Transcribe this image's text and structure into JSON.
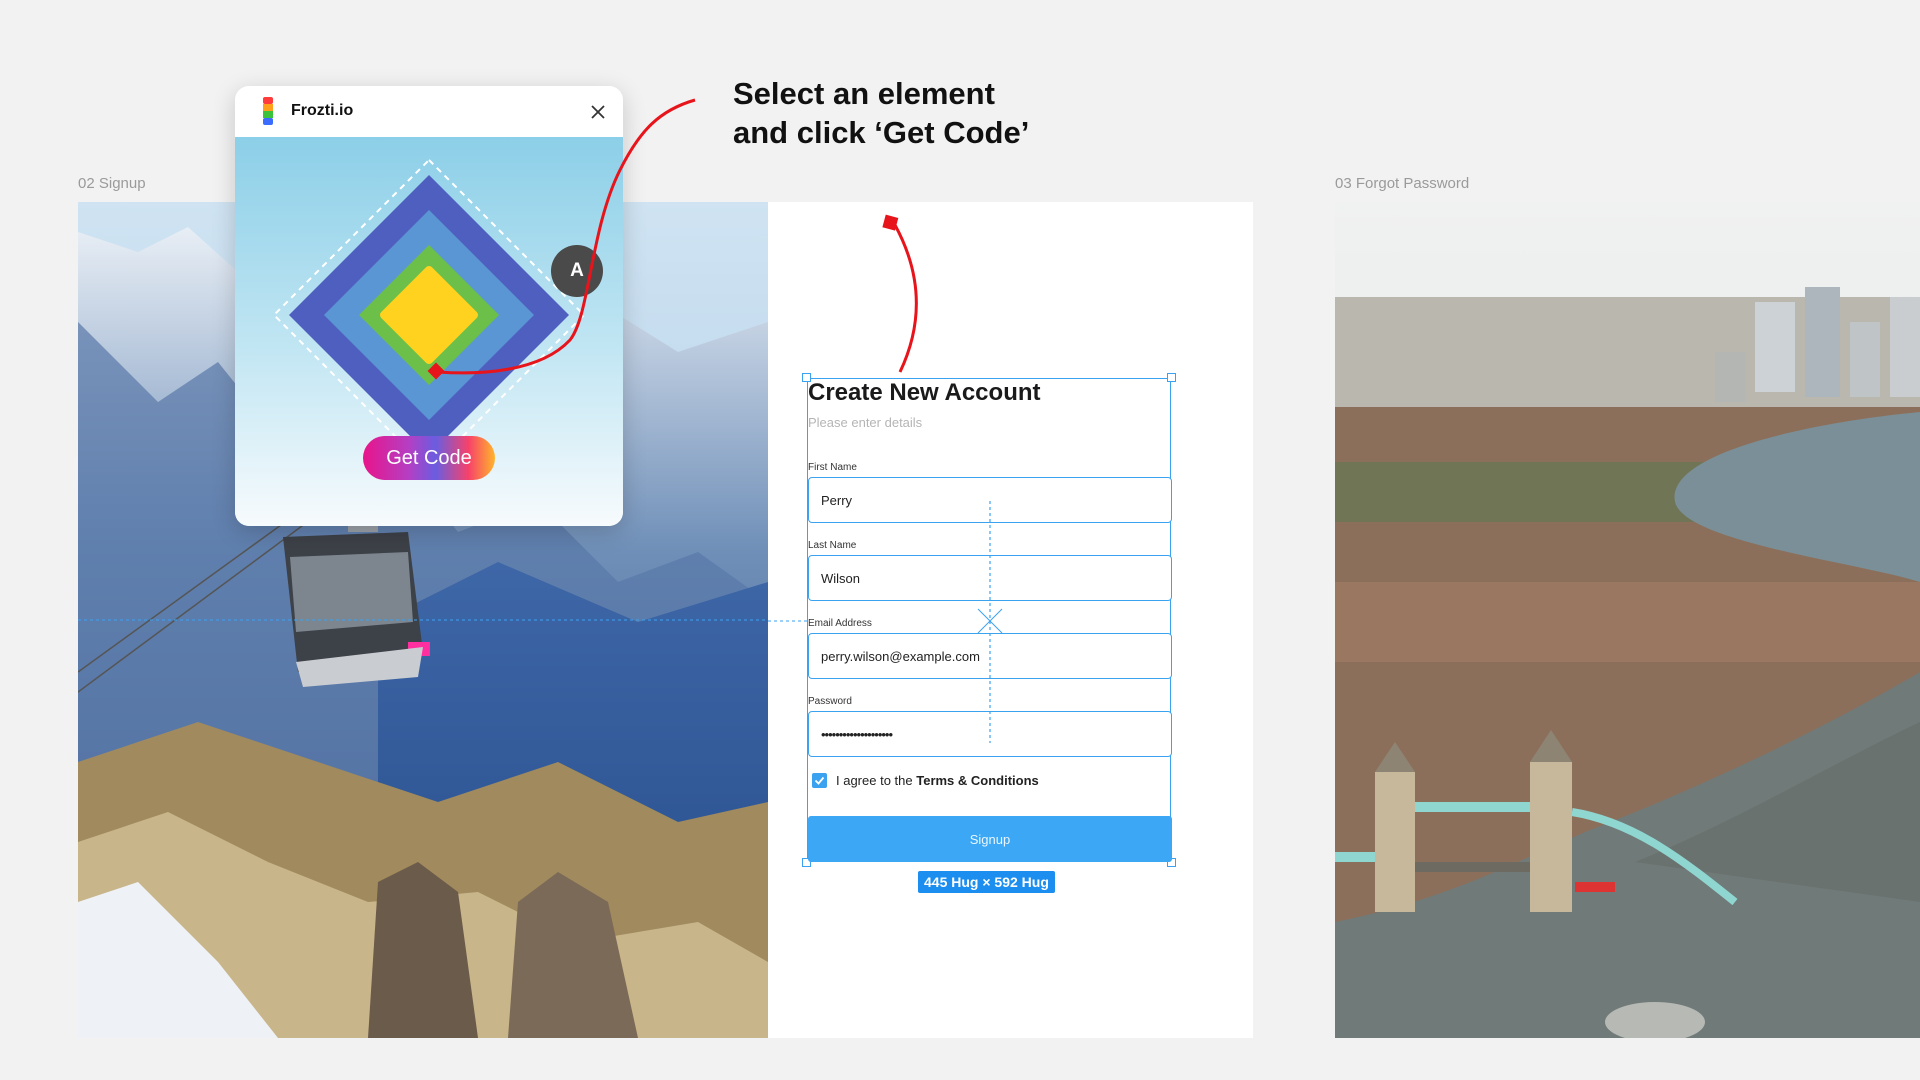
{
  "frames": {
    "signup_label": "02 Signup",
    "forgot_label": "03 Forgot Password"
  },
  "annotation": {
    "text": "Select an element and click ‘Get Code’"
  },
  "plugin": {
    "title": "Frozti.io",
    "avatar_initial": "A",
    "get_code_label": "Get Code",
    "close_icon": "close-icon"
  },
  "form": {
    "title": "Create New Account",
    "subtitle": "Please enter details",
    "fields": [
      {
        "label": "First Name",
        "value": "Perry"
      },
      {
        "label": "Last Name",
        "value": "Wilson"
      },
      {
        "label": "Email Address",
        "value": "perry.wilson@example.com"
      },
      {
        "label": "Password",
        "value": "••••••••••••••••••••"
      }
    ],
    "agree_prefix": "I agree to the ",
    "agree_link": "Terms & Conditions",
    "signup_label": "Signup",
    "terms_checked": true
  },
  "selection": {
    "size_badge": "445 Hug × 592 Hug"
  },
  "colors": {
    "accent": "#3ba2f0",
    "annotation_line": "#e8141b",
    "badge": "#1b8ef0"
  }
}
